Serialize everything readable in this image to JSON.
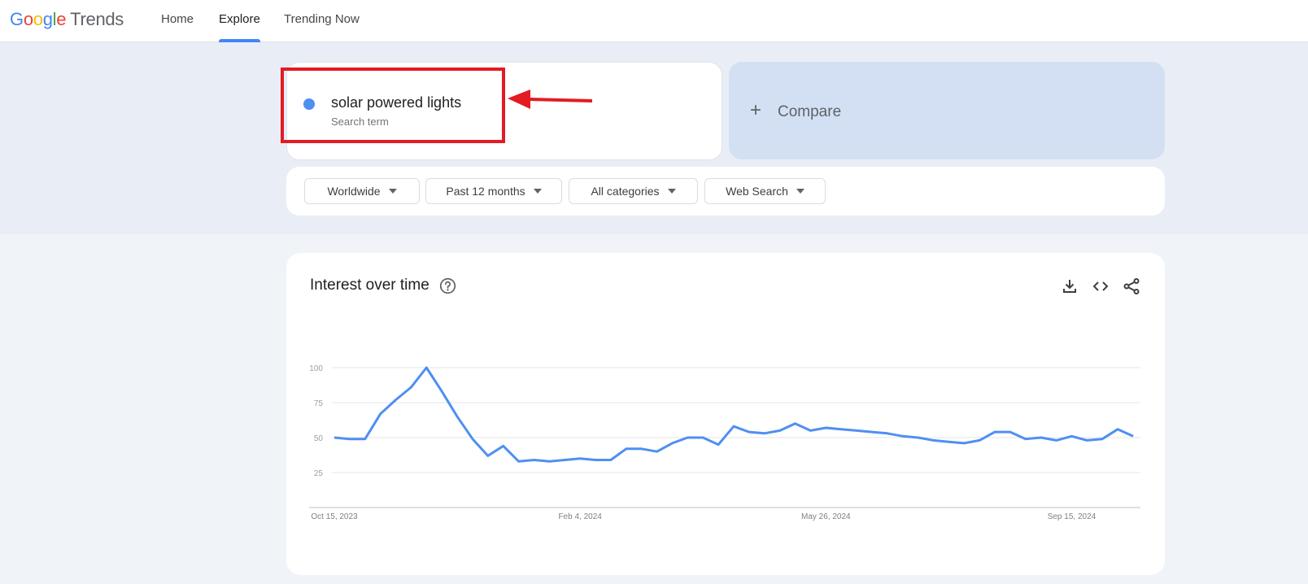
{
  "header": {
    "logo_letters": [
      "G",
      "o",
      "o",
      "g",
      "l",
      "e"
    ],
    "logo_product": "Trends",
    "nav": [
      {
        "label": "Home",
        "active": false
      },
      {
        "label": "Explore",
        "active": true
      },
      {
        "label": "Trending Now",
        "active": false
      }
    ]
  },
  "search": {
    "term": "solar powered lights",
    "term_type": "Search term",
    "term_color": "#4f8ff2",
    "compare_icon": "+",
    "compare_label": "Compare"
  },
  "filters": [
    {
      "label": "Worldwide"
    },
    {
      "label": "Past 12 months"
    },
    {
      "label": "All categories"
    },
    {
      "label": "Web Search"
    }
  ],
  "annotation": {
    "highlight_color": "#e31b23"
  },
  "interest_over_time": {
    "title": "Interest over time",
    "icons": [
      "help-icon",
      "download-icon",
      "embed-code-icon",
      "share-icon"
    ]
  },
  "chart_data": {
    "type": "line",
    "title": "Interest over time",
    "xlabel": "",
    "ylabel": "",
    "ylim": [
      0,
      100
    ],
    "yticks": [
      25,
      50,
      75,
      100
    ],
    "xtick_labels": [
      {
        "label": "Oct 15, 2023",
        "index": 0
      },
      {
        "label": "Feb 4, 2024",
        "index": 16
      },
      {
        "label": "May 26, 2024",
        "index": 32
      },
      {
        "label": "Sep 15, 2024",
        "index": 48
      }
    ],
    "grid": true,
    "series": [
      {
        "name": "solar powered lights",
        "color": "#4f8ff2",
        "values": [
          50,
          49,
          49,
          67,
          77,
          86,
          100,
          83,
          65,
          49,
          37,
          44,
          33,
          34,
          33,
          34,
          35,
          34,
          34,
          42,
          42,
          40,
          46,
          50,
          50,
          45,
          58,
          54,
          53,
          55,
          60,
          55,
          57,
          56,
          55,
          54,
          53,
          51,
          50,
          48,
          47,
          46,
          48,
          54,
          54,
          49,
          50,
          48,
          51,
          48,
          49,
          56,
          51
        ]
      }
    ]
  }
}
